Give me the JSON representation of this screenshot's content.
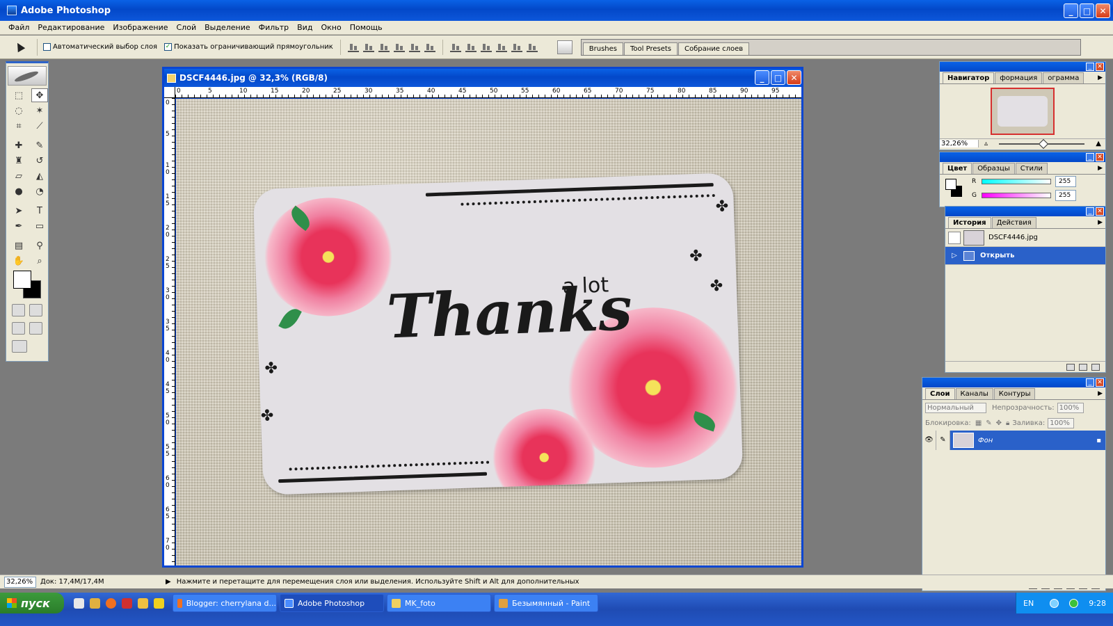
{
  "app": {
    "title": "Adobe Photoshop",
    "menu": [
      "Файл",
      "Редактирование",
      "Изображение",
      "Слой",
      "Выделение",
      "Фильтр",
      "Вид",
      "Окно",
      "Помощь"
    ]
  },
  "options_bar": {
    "auto_select_label": "Автоматический выбор слоя",
    "auto_select_checked": false,
    "show_bounds_label": "Показать ограничивающий прямоугольник",
    "show_bounds_checked": true,
    "palette_tabs": [
      "Brushes",
      "Tool Presets",
      "Собрание слоев"
    ]
  },
  "document": {
    "title": "DSCF4446.jpg @ 32,3% (RGB/8)",
    "ruler_h": [
      "0",
      "5",
      "10",
      "15",
      "20",
      "25",
      "30",
      "35",
      "40",
      "45",
      "50",
      "55",
      "60",
      "65",
      "70",
      "75",
      "80",
      "85",
      "90",
      "95"
    ],
    "ruler_v": [
      "0",
      "5",
      "1 0",
      "1 5",
      "2 0",
      "2 5",
      "3 0",
      "3 5",
      "4 0",
      "4 5",
      "5 0",
      "5 5",
      "6 0",
      "6 5",
      "7 0"
    ],
    "card_text_main": "Thanks",
    "card_text_small": "a lot"
  },
  "navigator": {
    "tabs": [
      "Навигатор",
      "формация",
      "ограмма"
    ],
    "zoom": "32,26%"
  },
  "color": {
    "tabs": [
      "Цвет",
      "Образцы",
      "Стили"
    ],
    "r_label": "R",
    "r_value": "255",
    "g_label": "G",
    "g_value": "255"
  },
  "history": {
    "tabs": [
      "История",
      "Действия"
    ],
    "snapshot": "DSCF4446.jpg",
    "steps": [
      "Открыть"
    ]
  },
  "layers": {
    "tabs": [
      "Слои",
      "Каналы",
      "Контуры"
    ],
    "blend_mode": "Нормальный",
    "opacity_label": "Непрозрачность:",
    "opacity_value": "100%",
    "lock_label": "Блокировка:",
    "fill_label": "Заливка:",
    "fill_value": "100%",
    "items": [
      "Фон"
    ]
  },
  "status": {
    "zoom": "32,26%",
    "doc_size": "Док: 17,4M/17,4M",
    "hint": "Нажмите и перетащите для перемещения слоя или выделения. Используйте Shift и Alt для дополнительных"
  },
  "taskbar": {
    "start_label": "пуск",
    "tasks": [
      "Blogger: cherrylana d...",
      "Adobe Photoshop",
      "MK_foto",
      "Безымянный - Paint"
    ],
    "lang": "EN",
    "clock": "9:28"
  },
  "colors": {
    "xp_blue": "#0a46d2",
    "selection_blue": "#2a61c9",
    "panel_bg": "#ece9d8",
    "rose_pink": "#e8335a"
  }
}
